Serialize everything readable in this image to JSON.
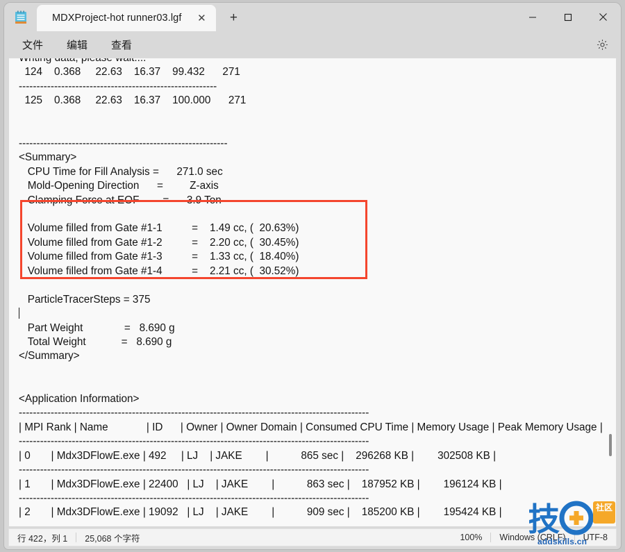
{
  "window": {
    "app_icon": "notepad-icon",
    "minimize_label": "—",
    "maximize_label": "□",
    "close_label": "✕"
  },
  "tabs": [
    {
      "title": "MDXProject-hot runner03.lgf",
      "close_label": "✕",
      "active": true
    }
  ],
  "new_tab_label": "+",
  "menu": {
    "items": [
      {
        "label": "文件"
      },
      {
        "label": "编辑"
      },
      {
        "label": "查看"
      }
    ],
    "settings_icon": "gear-icon"
  },
  "editor": {
    "lines": [
      "Writing data, please wait....",
      "  124    0.368     22.63    16.37    99.432      271",
      "--------------------------------------------------------",
      "  125    0.368     22.63    16.37    100.000      271",
      "",
      "",
      "-----------------------------------------------------------",
      "<Summary>",
      "   CPU Time for Fill Analysis =      271.0 sec",
      "   Mold-Opening Direction      =         Z-axis",
      "   Clamping Force at EOF        =      3.9 Ton",
      "",
      "   Volume filled from Gate #1-1          =    1.49 cc, (  20.63%)",
      "   Volume filled from Gate #1-2          =    2.20 cc, (  30.45%)",
      "   Volume filled from Gate #1-3          =    1.33 cc, (  18.40%)",
      "   Volume filled from Gate #1-4          =    2.21 cc, (  30.52%)",
      "",
      "   ParticleTracerSteps = 375",
      "",
      "   Part Weight              =   8.690 g",
      "   Total Weight            =   8.690 g",
      "</Summary>",
      "",
      "",
      "<Application Information>",
      "---------------------------------------------------------------------------------------------------",
      "| MPI Rank | Name             | ID      | Owner | Owner Domain | Consumed CPU Time | Memory Usage | Peak Memory Usage |",
      "---------------------------------------------------------------------------------------------------",
      "| 0       | Mdx3DFlowE.exe | 492     | LJ    | JAKE        |           865 sec |    296268 KB |        302508 KB |",
      "---------------------------------------------------------------------------------------------------",
      "| 1       | Mdx3DFlowE.exe | 22400   | LJ    | JAKE        |           863 sec |    187952 KB |        196124 KB |",
      "---------------------------------------------------------------------------------------------------",
      "| 2       | Mdx3DFlowE.exe | 19092   | LJ    | JAKE        |           909 sec |    185200 KB |        195424 KB |",
      "---------------------------------------------------------------------------------------------------"
    ],
    "highlight_color": "#f4462e",
    "caret_line_index": 18
  },
  "statusbar": {
    "position": "行 422，列 1",
    "char_count": "25,068 个字符",
    "zoom": "100%",
    "line_ending": "Windows (CRLF)",
    "encoding": "UTF-8"
  },
  "watermark": {
    "site": "addskills.cn",
    "badge": "社区",
    "brand": "技"
  }
}
